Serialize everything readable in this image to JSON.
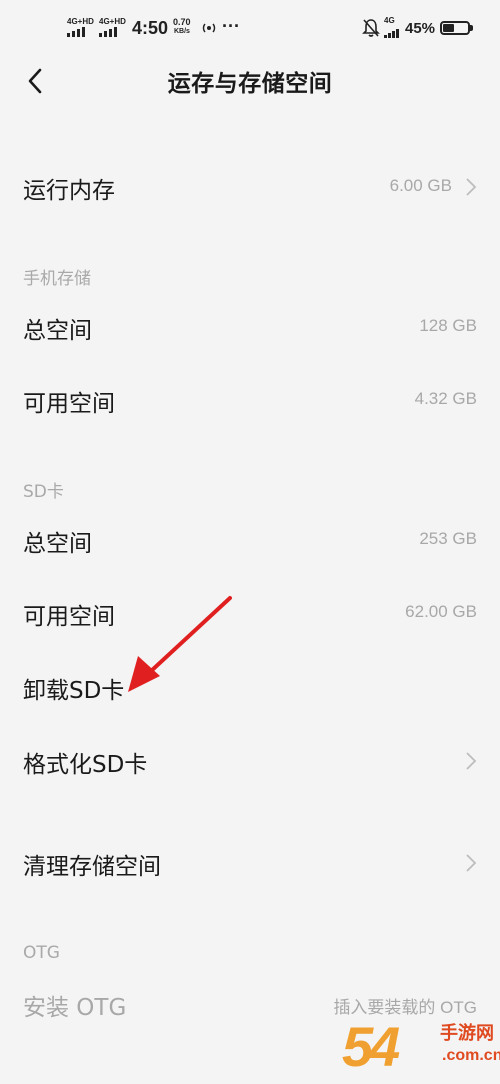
{
  "status_bar": {
    "net1": "4G+HD",
    "net2": "4G+HD",
    "time": "4:50",
    "speed_value": "0.70",
    "speed_unit": "KB/s",
    "more": "···",
    "net3": "4G",
    "battery": "45%",
    "battery_level": 0.45
  },
  "header": {
    "title": "运存与存储空间"
  },
  "ram": {
    "label": "运行内存",
    "value": "6.00 GB"
  },
  "phone_storage": {
    "section_title": "手机存储",
    "total_label": "总空间",
    "total_value": "128 GB",
    "available_label": "可用空间",
    "available_value": "4.32 GB"
  },
  "sd_card": {
    "section_title": "SD卡",
    "total_label": "总空间",
    "total_value": "253 GB",
    "available_label": "可用空间",
    "available_value": "62.00 GB",
    "unmount_label": "卸载SD卡",
    "format_label": "格式化SD卡"
  },
  "cleanup": {
    "label": "清理存储空间"
  },
  "otg": {
    "section_title": "OTG",
    "install_label": "安装 OTG",
    "install_value": "插入要装载的 OTG"
  },
  "watermark": {
    "number": "54",
    "brand": "手游网",
    "url": ".com.cn"
  },
  "colors": {
    "background": "#f4f4f4",
    "text": "#1a1a1a",
    "secondary": "#a8a8a8",
    "arrow": "#e02020"
  }
}
